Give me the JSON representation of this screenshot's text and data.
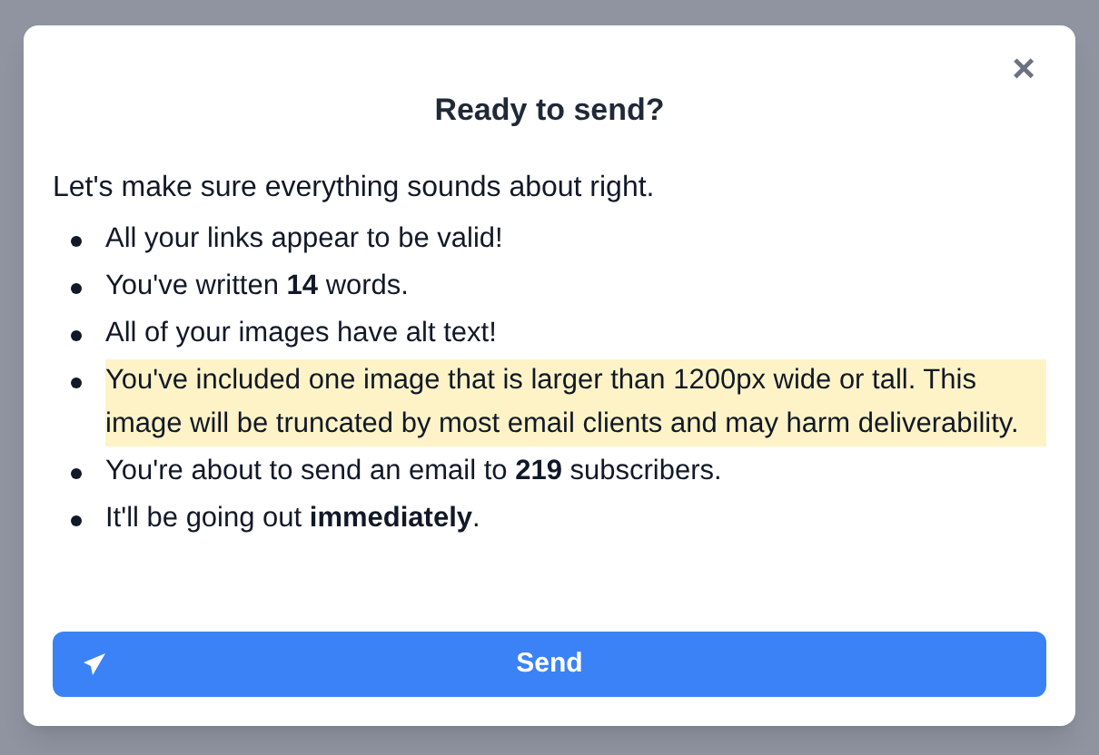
{
  "dialog": {
    "title": "Ready to send?",
    "close": "×",
    "intro": "Let's make sure everything sounds about right.",
    "items": [
      {
        "text": "All your links appear to be valid!",
        "highlighted": false
      },
      {
        "text": "You've written **14** words.",
        "highlighted": false
      },
      {
        "text": "All of your images have alt text!",
        "highlighted": false
      },
      {
        "text": "You've included one image that is larger than 1200px wide or tall. This image will be truncated by most email clients and may harm deliverability.",
        "highlighted": true
      },
      {
        "text": "You're about to send an email to **219** subscribers.",
        "highlighted": false
      },
      {
        "text": "It'll be going out **immediately**.",
        "highlighted": false
      }
    ],
    "button": "Send"
  }
}
